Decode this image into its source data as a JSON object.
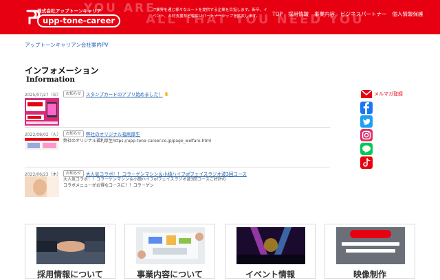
{
  "header": {
    "bg_line1": "YOU ARE",
    "bg_line2a": "ALL THAT",
    "bg_line2b": "YOU NEED YOU",
    "logo_tag": "株式会社アップトーンキャリア",
    "logo_text": "upp-tone-career",
    "tagline": "IT業界を通じ様々なルートを提供する企業を目指します。新卒、イベント、人材支援など幅広いパートナーシップを拡大します。",
    "nav": [
      "TOP",
      "採用情報",
      "事業内容",
      "ビジネスパートナー",
      "個人情報保護"
    ]
  },
  "pv_link": "アップトーンキャリアン会社案内PV",
  "info": {
    "title": "インフォメーション",
    "subtitle": "Information",
    "items": [
      {
        "date": "2025/07/27（日）",
        "badge": "お知らせ",
        "title": "スタンプカードのアプリ始めました！",
        "body": ""
      },
      {
        "date": "2022/08/02（火）",
        "badge": "お知らせ",
        "title": "弊社のオリジナル福利厚生",
        "body": "弊社のオリジナル福利厚生https://upp-tone-career.co.jp/page_welfare.html"
      },
      {
        "date": "2022/06/23（木）",
        "badge": "お知らせ",
        "title": "大人気コラボ！！コラーゲンマシン＆小顔ハイフofフェイスラジオ波3回コース",
        "body": "大人気コラボ！！コラーゲンマシン＆小顔ハイフofフェイスラジオ波3回コースご好評のコラボメニューがお得なコースに！！コラーゲン"
      }
    ]
  },
  "social": {
    "mail_label": "メルマガ登録",
    "icons": [
      "mail-icon",
      "facebook-icon",
      "twitter-icon",
      "instagram-icon",
      "line-icon",
      "tiktok-icon"
    ]
  },
  "cards": [
    {
      "title": "採用情報について"
    },
    {
      "title": "事業内容について"
    },
    {
      "title": "イベント情報"
    },
    {
      "title": "映像制作"
    }
  ],
  "colors": {
    "brand": "#e60012",
    "link": "#1a5fb4"
  }
}
